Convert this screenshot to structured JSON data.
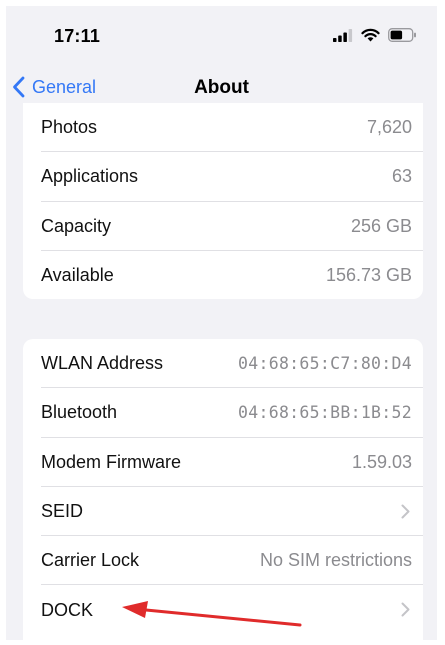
{
  "status_bar": {
    "time": "17:11",
    "icons": [
      "cellular-signal-icon",
      "wifi-icon",
      "battery-icon"
    ]
  },
  "nav": {
    "back_label": "General",
    "title": "About",
    "accent_color": "#3478f6"
  },
  "storage_group": {
    "rows": [
      {
        "label": "Photos",
        "value": "7,620"
      },
      {
        "label": "Applications",
        "value": "63"
      },
      {
        "label": "Capacity",
        "value": "256 GB"
      },
      {
        "label": "Available",
        "value": "156.73 GB"
      }
    ]
  },
  "network_group": {
    "rows": [
      {
        "label": "WLAN Address",
        "value": "04:68:65:C7:80:D4"
      },
      {
        "label": "Bluetooth",
        "value": "04:68:65:BB:1B:52"
      },
      {
        "label": "Modem Firmware",
        "value": "1.59.03"
      },
      {
        "label": "SEID",
        "value": ""
      },
      {
        "label": "Carrier Lock",
        "value": "No SIM restrictions"
      },
      {
        "label": "DOCK",
        "value": ""
      }
    ]
  },
  "annotation": {
    "arrow_color": "#e02b2b",
    "points_to": "DOCK"
  }
}
